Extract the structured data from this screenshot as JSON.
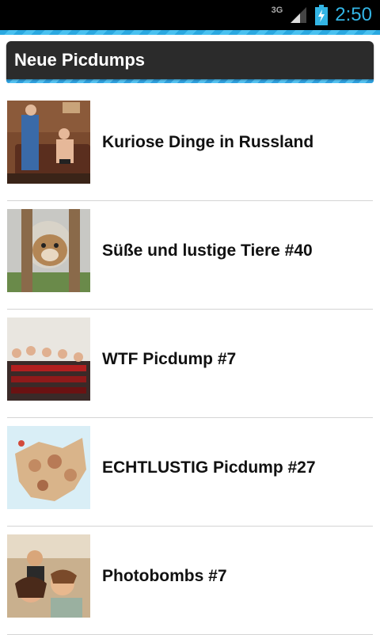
{
  "status_bar": {
    "network": "3G",
    "time": "2:50"
  },
  "header": {
    "title": "Neue Picdumps"
  },
  "items": [
    {
      "title": "Kuriose Dinge in Russland"
    },
    {
      "title": "Süße und lustige Tiere #40"
    },
    {
      "title": "WTF Picdump #7"
    },
    {
      "title": "ECHTLUSTIG Picdump #27"
    },
    {
      "title": "Photobombs #7"
    }
  ],
  "colors": {
    "accent": "#33b5e5",
    "titlebar": "#2b2b2b",
    "divider": "#d4d4d4"
  }
}
